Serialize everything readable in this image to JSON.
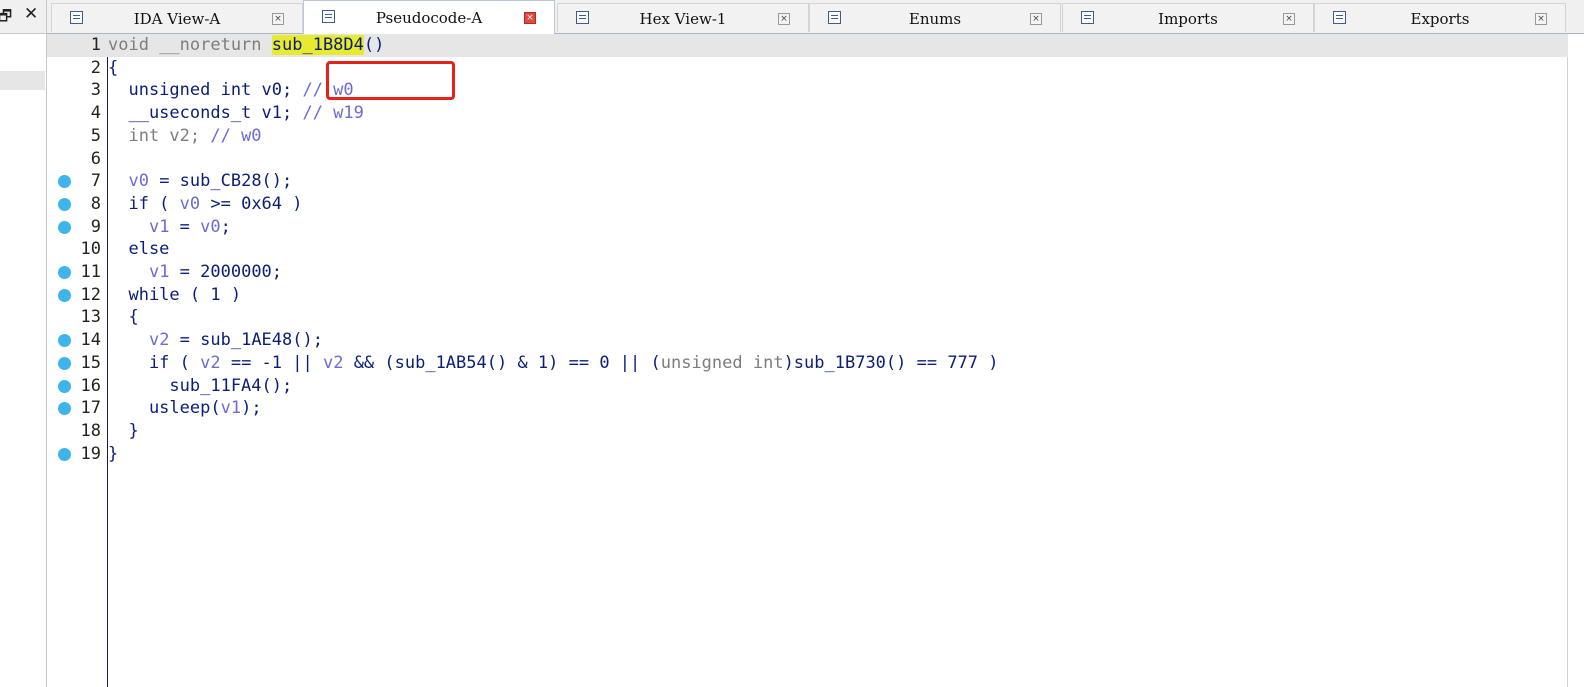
{
  "window": {
    "restore_glyph": "🗗",
    "close_glyph": "✕"
  },
  "tabs": [
    {
      "label": "IDA View-A",
      "icon": "ida-view-icon",
      "active": false
    },
    {
      "label": "Pseudocode-A",
      "icon": "pseudocode-icon",
      "active": true
    },
    {
      "label": "Hex View-1",
      "icon": "hex-view-icon",
      "active": false
    },
    {
      "label": "Enums",
      "icon": "enums-icon",
      "active": false
    },
    {
      "label": "Imports",
      "icon": "imports-icon",
      "active": false
    },
    {
      "label": "Exports",
      "icon": "exports-icon",
      "active": false
    }
  ],
  "tab_close_glyph": "×",
  "colors": {
    "keyword": "#0a1e78",
    "variable": "#6b6bd6",
    "gray": "#7d7d7d",
    "highlight": "#e7ea2e",
    "annotation": "#e8201a",
    "breakpoint": "#3fb4ea"
  },
  "code": {
    "lines": [
      {
        "n": "1",
        "bp": false,
        "cur": true,
        "parts": [
          {
            "t": "void __noreturn ",
            "c": "g"
          },
          {
            "t": "sub_1B8D4",
            "c": "hl"
          },
          {
            "t": "()",
            "c": ""
          }
        ]
      },
      {
        "n": "2",
        "bp": false,
        "parts": [
          {
            "t": "{",
            "c": ""
          }
        ]
      },
      {
        "n": "3",
        "bp": false,
        "parts": [
          {
            "t": "  unsigned int v0; ",
            "c": ""
          },
          {
            "t": "// w0",
            "c": "v"
          }
        ]
      },
      {
        "n": "4",
        "bp": false,
        "parts": [
          {
            "t": "  __useconds_t v1; ",
            "c": ""
          },
          {
            "t": "// w19",
            "c": "v"
          }
        ]
      },
      {
        "n": "5",
        "bp": false,
        "parts": [
          {
            "t": "  int v2; ",
            "c": "g"
          },
          {
            "t": "// w0",
            "c": "v"
          }
        ]
      },
      {
        "n": "6",
        "bp": false,
        "parts": []
      },
      {
        "n": "7",
        "bp": true,
        "parts": [
          {
            "t": "  ",
            "c": ""
          },
          {
            "t": "v0",
            "c": "v"
          },
          {
            "t": " = sub_CB28();",
            "c": ""
          }
        ]
      },
      {
        "n": "8",
        "bp": true,
        "parts": [
          {
            "t": "  if ( ",
            "c": ""
          },
          {
            "t": "v0",
            "c": "v"
          },
          {
            "t": " >= 0x64 )",
            "c": ""
          }
        ]
      },
      {
        "n": "9",
        "bp": true,
        "parts": [
          {
            "t": "    ",
            "c": ""
          },
          {
            "t": "v1",
            "c": "v"
          },
          {
            "t": " = ",
            "c": ""
          },
          {
            "t": "v0",
            "c": "v"
          },
          {
            "t": ";",
            "c": ""
          }
        ]
      },
      {
        "n": "10",
        "bp": false,
        "parts": [
          {
            "t": "  else",
            "c": ""
          }
        ]
      },
      {
        "n": "11",
        "bp": true,
        "parts": [
          {
            "t": "    ",
            "c": ""
          },
          {
            "t": "v1",
            "c": "v"
          },
          {
            "t": " = 2000000;",
            "c": ""
          }
        ]
      },
      {
        "n": "12",
        "bp": true,
        "parts": [
          {
            "t": "  while ( 1 )",
            "c": ""
          }
        ]
      },
      {
        "n": "13",
        "bp": false,
        "parts": [
          {
            "t": "  {",
            "c": ""
          }
        ]
      },
      {
        "n": "14",
        "bp": true,
        "parts": [
          {
            "t": "    ",
            "c": ""
          },
          {
            "t": "v2",
            "c": "v"
          },
          {
            "t": " = sub_1AE48();",
            "c": ""
          }
        ]
      },
      {
        "n": "15",
        "bp": true,
        "parts": [
          {
            "t": "    if ( ",
            "c": ""
          },
          {
            "t": "v2",
            "c": "v"
          },
          {
            "t": " == -1 || ",
            "c": ""
          },
          {
            "t": "v2",
            "c": "v"
          },
          {
            "t": " && (sub_1AB54() & 1) == 0 || (",
            "c": ""
          },
          {
            "t": "unsigned int",
            "c": "g"
          },
          {
            "t": ")sub_1B730() == 777 )",
            "c": ""
          }
        ]
      },
      {
        "n": "16",
        "bp": true,
        "parts": [
          {
            "t": "      sub_11FA4();",
            "c": ""
          }
        ]
      },
      {
        "n": "17",
        "bp": true,
        "parts": [
          {
            "t": "    usleep(",
            "c": ""
          },
          {
            "t": "v1",
            "c": "v"
          },
          {
            "t": ");",
            "c": ""
          }
        ]
      },
      {
        "n": "18",
        "bp": false,
        "parts": [
          {
            "t": "  }",
            "c": ""
          }
        ]
      },
      {
        "n": "19",
        "bp": true,
        "parts": [
          {
            "t": "}",
            "c": ""
          }
        ]
      }
    ]
  }
}
